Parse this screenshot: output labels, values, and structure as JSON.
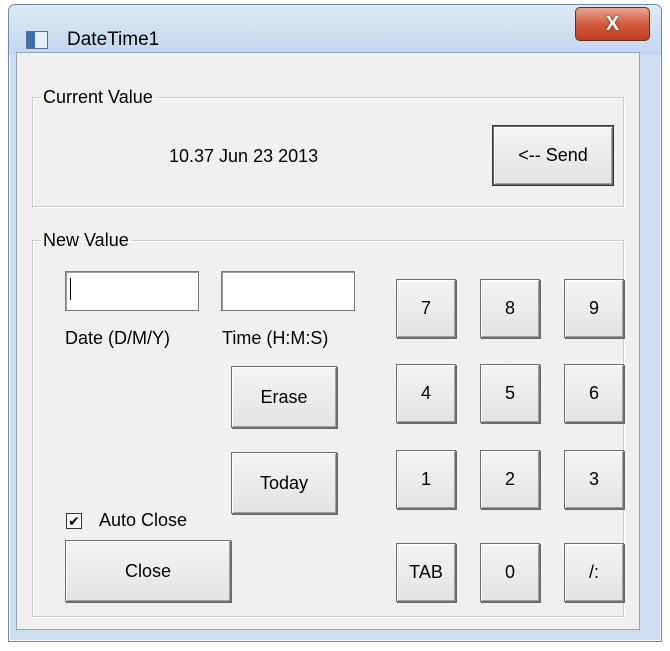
{
  "window": {
    "title": "DateTime1",
    "close_label": "X"
  },
  "current": {
    "legend": "Current Value",
    "value": "10.37 Jun 23 2013",
    "send_label": "<-- Send"
  },
  "new": {
    "legend": "New Value",
    "date_label": "Date (D/M/Y)",
    "time_label": "Time (H:M:S)",
    "date_value": "",
    "time_value": "",
    "erase_label": "Erase",
    "today_label": "Today",
    "auto_close_label": "Auto Close",
    "auto_close_checked": true,
    "close_label": "Close"
  },
  "keypad": [
    "7",
    "8",
    "9",
    "4",
    "5",
    "6",
    "1",
    "2",
    "3",
    "TAB",
    "0",
    "/:"
  ]
}
